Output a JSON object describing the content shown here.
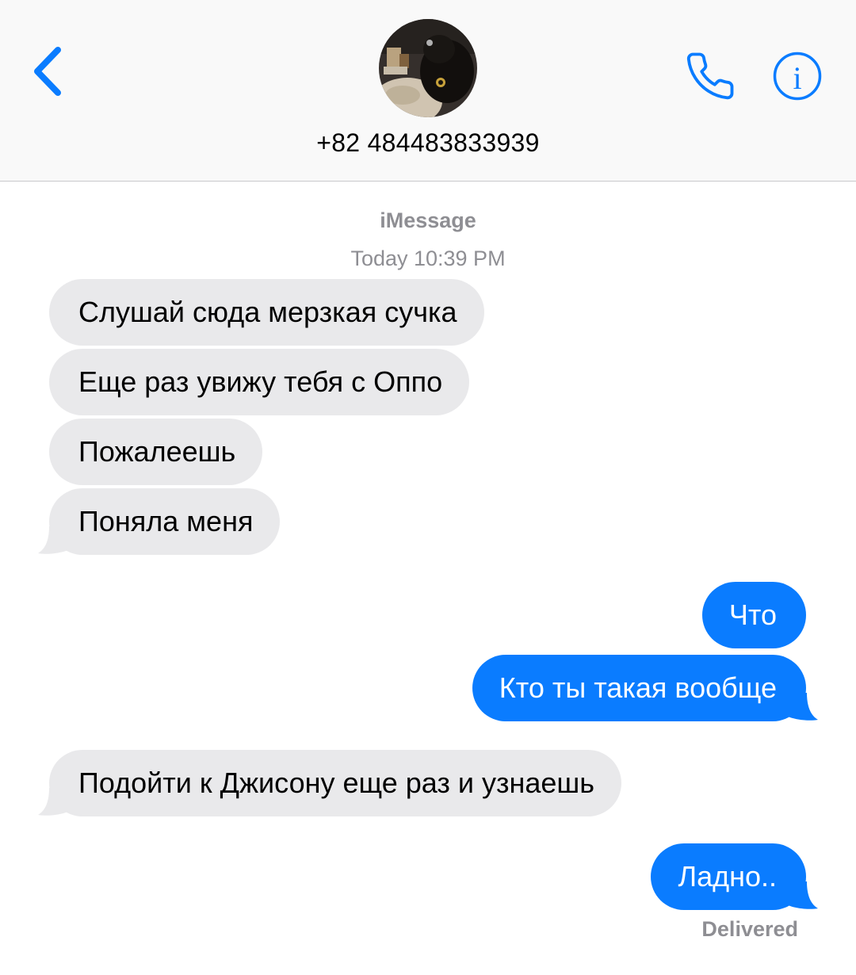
{
  "header": {
    "contact_name": "+82 484483833939",
    "back_icon": "chevron-left-icon",
    "call_icon": "phone-icon",
    "info_icon": "info-icon",
    "accent_color": "#0a7cff"
  },
  "conversation": {
    "service": "iMessage",
    "timestamp": "Today 10:39 PM",
    "messages": [
      {
        "direction": "incoming",
        "text": "Слушай сюда мерзкая сучка"
      },
      {
        "direction": "incoming",
        "text": "Еще раз увижу тебя с Оппо"
      },
      {
        "direction": "incoming",
        "text": "Пожалеешь"
      },
      {
        "direction": "incoming",
        "text": "Поняла меня"
      },
      {
        "direction": "outgoing",
        "text": "Что"
      },
      {
        "direction": "outgoing",
        "text": "Кто ты такая вообще"
      },
      {
        "direction": "incoming",
        "text": "Подойти к Джисону еще раз и узнаешь"
      },
      {
        "direction": "outgoing",
        "text": "Ладно.."
      }
    ],
    "status": "Delivered",
    "incoming_color": "#e9e9eb",
    "outgoing_color": "#0a7cff"
  }
}
